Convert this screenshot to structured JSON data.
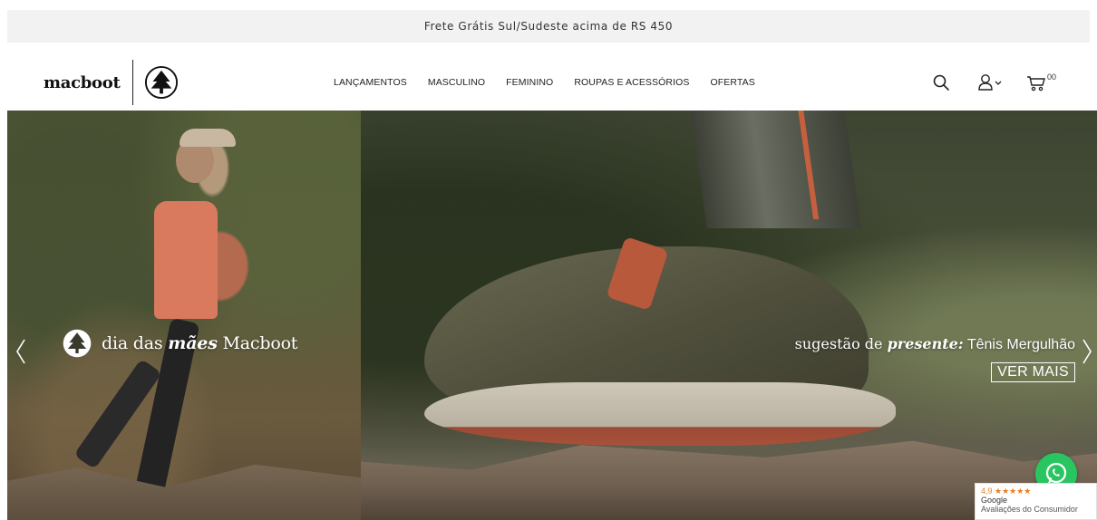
{
  "promo_bar": {
    "text": "Frete Grátis Sul/Sudeste acima de RS 450"
  },
  "header": {
    "logo_text": "macboot",
    "nav": [
      {
        "label": "LANÇAMENTOS"
      },
      {
        "label": "MASCULINO"
      },
      {
        "label": "FEMININO"
      },
      {
        "label": "ROUPAS E ACESSÓRIOS"
      },
      {
        "label": "OFERTAS"
      }
    ],
    "tools": {
      "search_icon": "search-icon",
      "account_icon": "user-icon",
      "cart_icon": "cart-icon",
      "cart_count": "00"
    }
  },
  "hero": {
    "left_caption": {
      "prefix": "dia das ",
      "emphasis": "mães",
      "suffix": " Macboot"
    },
    "right_caption": {
      "prefix": "sugestão de ",
      "emphasis": "presente:",
      "product": " Tênis Mergulhão",
      "cta": "VER MAIS"
    },
    "arrows": {
      "prev": "chevron-left-icon",
      "next": "chevron-right-icon"
    }
  },
  "floating": {
    "whatsapp_icon": "whatsapp-icon",
    "review": {
      "rating": "4,9 ★★★★★",
      "provider": "Google",
      "label": "Avaliações do Consumidor"
    }
  },
  "colors": {
    "promo_bg": "#f2f2f2",
    "whatsapp": "#29c561",
    "accent_orange": "#d97a5e"
  }
}
